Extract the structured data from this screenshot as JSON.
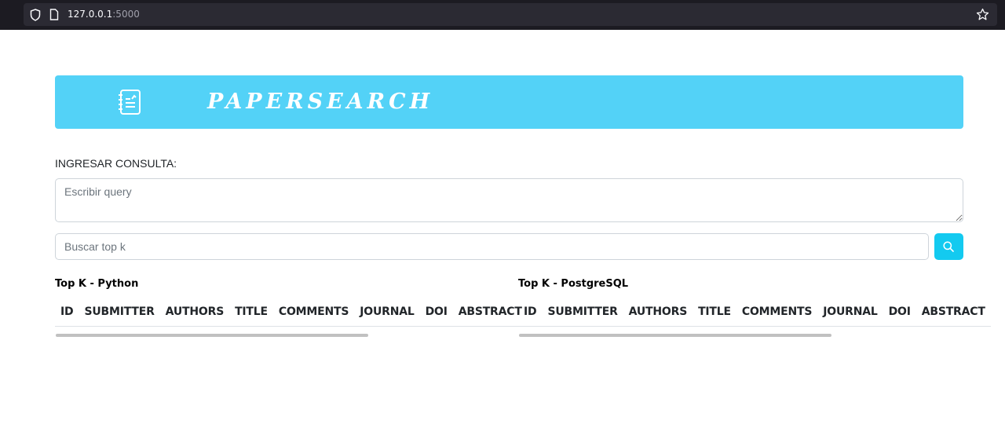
{
  "browser": {
    "url_host": "127.0.0.1",
    "url_port": ":5000"
  },
  "header": {
    "brand": "PAPERSEARCH",
    "logo_icon": "notebook-icon",
    "color": "#53d2f7"
  },
  "query": {
    "label": "INGRESAR CONSULTA:",
    "placeholder": "Escribir query",
    "value": ""
  },
  "topk": {
    "placeholder": "Buscar top k",
    "value": "",
    "search_icon": "search-icon",
    "button_color": "#13caf0"
  },
  "results": {
    "python": {
      "title": "Top K - Python",
      "columns": [
        "ID",
        "SUBMITTER",
        "AUTHORS",
        "TITLE",
        "COMMENTS",
        "JOURNAL",
        "DOI",
        "ABSTRACT"
      ]
    },
    "postgres": {
      "title": "Top K - PostgreSQL",
      "columns": [
        "ID",
        "SUBMITTER",
        "AUTHORS",
        "TITLE",
        "COMMENTS",
        "JOURNAL",
        "DOI",
        "ABSTRACT"
      ]
    }
  }
}
